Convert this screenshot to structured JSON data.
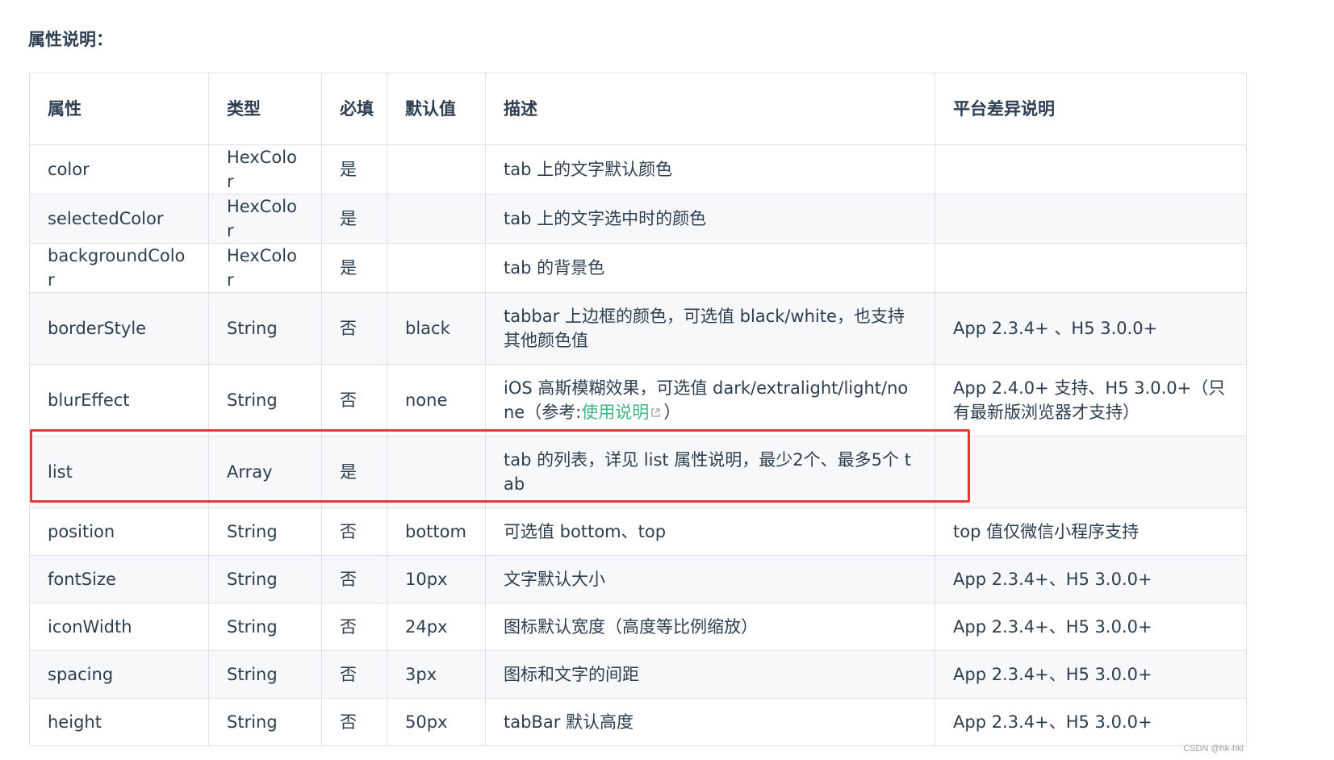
{
  "section_title": "属性说明：",
  "table": {
    "headers": {
      "attr": "属性",
      "type": "类型",
      "required": "必填",
      "default": "默认值",
      "desc": "描述",
      "platform": "平台差异说明"
    },
    "rows": [
      {
        "attr": "color",
        "type": "HexColor",
        "required": "是",
        "default": "",
        "desc": "tab 上的文字默认颜色",
        "platform": ""
      },
      {
        "attr": "selectedColor",
        "type": "HexColor",
        "required": "是",
        "default": "",
        "desc": "tab 上的文字选中时的颜色",
        "platform": ""
      },
      {
        "attr": "backgroundColor",
        "type": "HexColor",
        "required": "是",
        "default": "",
        "desc": "tab 的背景色",
        "platform": ""
      },
      {
        "attr": "borderStyle",
        "type": "String",
        "required": "否",
        "default": "black",
        "desc": "tabbar 上边框的颜色，可选值 black/white，也支持其他颜色值",
        "platform": "App 2.3.4+ 、H5 3.0.0+"
      },
      {
        "attr": "blurEffect",
        "type": "String",
        "required": "否",
        "default": "none",
        "desc_prefix": "iOS 高斯模糊效果，可选值 dark/extralight/light/none（参考:",
        "desc_link": "使用说明",
        "desc_suffix": "）",
        "platform": "App 2.4.0+ 支持、H5 3.0.0+（只有最新版浏览器才支持）"
      },
      {
        "attr": "list",
        "type": "Array",
        "required": "是",
        "default": "",
        "desc": "tab 的列表，详见 list 属性说明，最少2个、最多5个 tab",
        "platform": ""
      },
      {
        "attr": "position",
        "type": "String",
        "required": "否",
        "default": "bottom",
        "desc": "可选值 bottom、top",
        "platform": "top 值仅微信小程序支持"
      },
      {
        "attr": "fontSize",
        "type": "String",
        "required": "否",
        "default": "10px",
        "desc": "文字默认大小",
        "platform": "App 2.3.4+、H5 3.0.0+"
      },
      {
        "attr": "iconWidth",
        "type": "String",
        "required": "否",
        "default": "24px",
        "desc": "图标默认宽度（高度等比例缩放）",
        "platform": "App 2.3.4+、H5 3.0.0+"
      },
      {
        "attr": "spacing",
        "type": "String",
        "required": "否",
        "default": "3px",
        "desc": "图标和文字的间距",
        "platform": "App 2.3.4+、H5 3.0.0+"
      },
      {
        "attr": "height",
        "type": "String",
        "required": "否",
        "default": "50px",
        "desc": "tabBar 默认高度",
        "platform": "App 2.3.4+、H5 3.0.0+"
      }
    ]
  },
  "colors": {
    "text": "#2c3e50",
    "link": "#42b983",
    "border": "#dfe2e5",
    "stripe": "#f6f8fa",
    "highlight": "#e53935"
  },
  "icons": {
    "external_link": "external-link-icon"
  },
  "watermark": "CSDN @hk-hkl"
}
